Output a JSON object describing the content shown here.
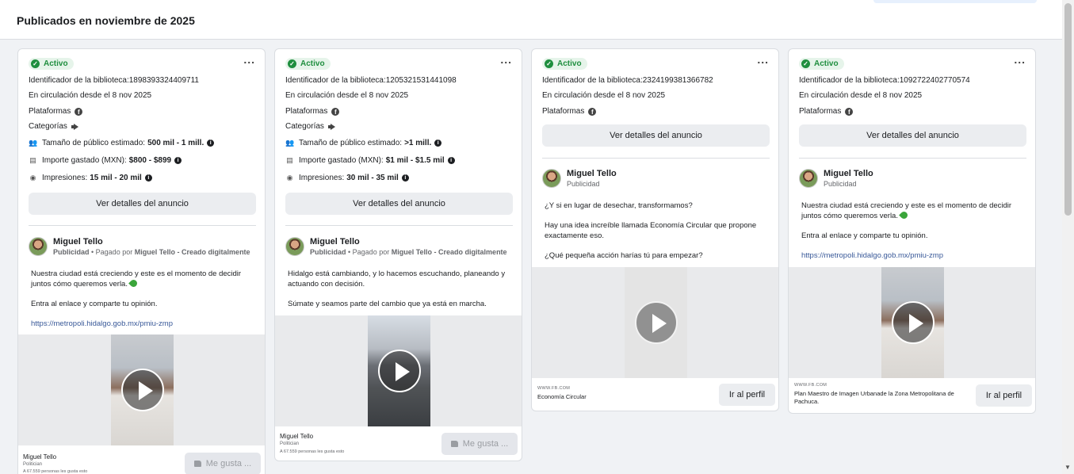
{
  "page": {
    "title": "Publicados en noviembre de 2025"
  },
  "labels": {
    "more": "...",
    "status": "Activo",
    "library_prefix": "Identificador de la biblioteca: ",
    "since": "En circulación desde el 8 nov 2025",
    "platforms": "Plataformas",
    "categories": "Categorías",
    "audience": "Tamaño de público estimado:",
    "spend": "Importe gastado (MXN):",
    "impressions": "Impresiones:",
    "details": "Ver detalles del anuncio",
    "advertiser": "Miguel Tello",
    "sponsored": "Publicidad",
    "paid_by": " • Pagado por ",
    "paid_by_name": "Miguel Tello - Creado digitalmente",
    "foot_category": "Politician",
    "foot_likes": "A 67.559 personas les gusta esto",
    "like": "Me gusta ...",
    "profile": "Ir al perfil",
    "url_domain": "WWW.FB.COM"
  },
  "cards": [
    {
      "id": "1898393324409711",
      "audience": "500 mil - 1 mill.",
      "spend": "$800 - $899",
      "impressions": "15 mil - 20 mil",
      "text1": "Nuestra ciudad está creciendo y este es el momento de decidir juntos cómo queremos verla.",
      "text2": "Entra al enlace y comparte tu opinión.",
      "link": "https://metropoli.hidalgo.gob.mx/pmiu-zmp"
    },
    {
      "id": "1205321531441098",
      "audience": ">1 mill.",
      "spend": "$1 mil - $1.5 mil",
      "impressions": "30 mil - 35 mil",
      "text1": "Hidalgo está cambiando, y lo hacemos escuchando, planeando y actuando con decisión.",
      "text2": "Súmate y seamos parte del cambio que ya está en marcha."
    },
    {
      "id": "2324199381366782",
      "text1": "¿Y si en lugar de desechar, transformamos?",
      "text2": "Hay una idea increíble llamada Economía Circular que propone exactamente eso.",
      "text3": "¿Qué pequeña acción harías tú para empezar?",
      "url_title": "Economía Circular"
    },
    {
      "id": "1092722402770574",
      "text1": "Nuestra ciudad está creciendo y este es el momento de decidir juntos cómo queremos verla.",
      "text2": "Entra al enlace y comparte tu opinión.",
      "link": "https://metropoli.hidalgo.gob.mx/pmiu-zmp",
      "url_title": "Plan Maestro de Imagen Urbanade la Zona Metropolitana de Pachuca."
    }
  ],
  "colors": {
    "active_green": "#1e8e3e",
    "link_blue": "#385898",
    "button_grey": "#ebedf0"
  }
}
